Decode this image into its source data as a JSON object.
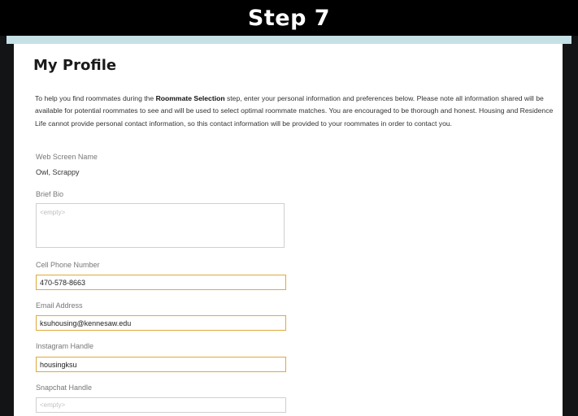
{
  "banner": {
    "title": "Step 7"
  },
  "profile": {
    "title": "My Profile",
    "intro_before": "To help you find roommates during the ",
    "intro_bold": "Roommate Selection",
    "intro_after": " step, enter your personal information and preferences below. Please note all information shared will be available for potential roommates to see and will be used to select optimal roommate matches. You are encouraged to be thorough and honest. Housing and Residence Life cannot provide personal contact information, so this contact information will be provided to your roommates in order to contact you."
  },
  "fields": {
    "web_screen_name": {
      "label": "Web Screen Name",
      "value": "Owl, Scrappy"
    },
    "brief_bio": {
      "label": "Brief Bio",
      "placeholder": "<empty>"
    },
    "cell_phone": {
      "label": "Cell Phone Number",
      "value": "470-578-8663"
    },
    "email": {
      "label": "Email Address",
      "value": "ksuhousing@kennesaw.edu"
    },
    "instagram": {
      "label": "Instagram Handle",
      "value": "housingksu"
    },
    "snapchat": {
      "label": "Snapchat Handle",
      "placeholder": "<empty>"
    }
  },
  "colors": {
    "accent_bar": "#c5e1e6",
    "input_highlight": "#e0a93a",
    "banner_bg": "#000000"
  }
}
